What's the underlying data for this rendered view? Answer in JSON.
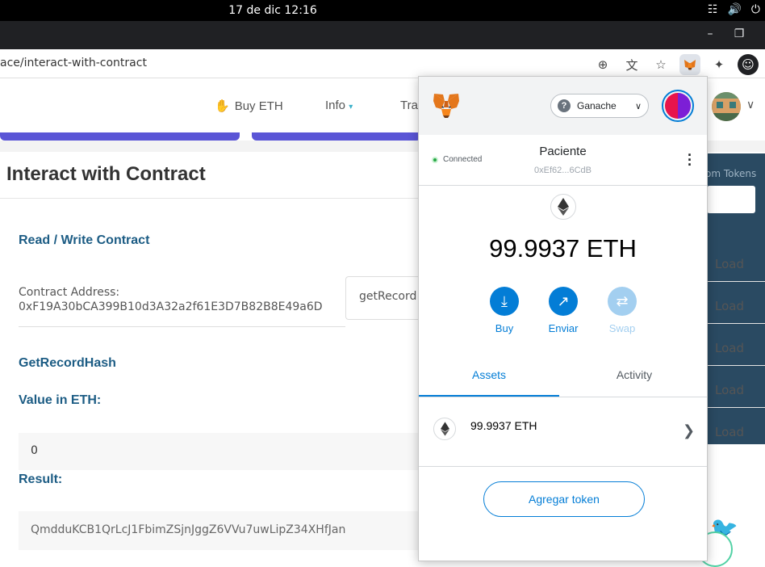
{
  "system_bar": {
    "clock": "17 de dic  12:16"
  },
  "browser": {
    "url": "ace/interact-with-contract"
  },
  "navbar": {
    "buy_eth": "Buy ETH",
    "info": "Info",
    "transactions_partial": "Tra"
  },
  "page": {
    "title": "Interact with Contract",
    "read_write_label": "Read / Write Contract",
    "contract_address_label": "Contract Address:",
    "contract_address_value": "0xF19A30bCA399B10d3A32a2f61E3D7B82B8E49a6D",
    "function_select_value": "getRecord",
    "function_name": "GetRecordHash",
    "value_label": "Value in ETH:",
    "value_input": "0",
    "result_label": "Result:",
    "result_value": "QmdduKCB1QrLcJ1FbimZSjnJggZ6VVu7uwLipZ34XHfJan",
    "tokens_partial": "om Tokens",
    "load_labels": [
      "Load",
      "Load",
      "Load",
      "Load",
      "Load"
    ]
  },
  "metamask": {
    "network": "Ganache",
    "connected_label": "Connected",
    "account_name": "Paciente",
    "account_address": "0xEf62...6CdB",
    "balance": "99.9937 ETH",
    "actions": [
      {
        "label": "Buy",
        "icon": "download-icon",
        "enabled": true
      },
      {
        "label": "Enviar",
        "icon": "send-arrow-icon",
        "enabled": true
      },
      {
        "label": "Swap",
        "icon": "swap-icon",
        "enabled": false
      }
    ],
    "tabs": [
      "Assets",
      "Activity"
    ],
    "active_tab": "Assets",
    "asset_amount": "99.9937 ETH",
    "add_token_label": "Agregar token",
    "colors": {
      "primary": "#037dd6",
      "disabled": "#a3cff0",
      "connected": "#28a745"
    }
  }
}
